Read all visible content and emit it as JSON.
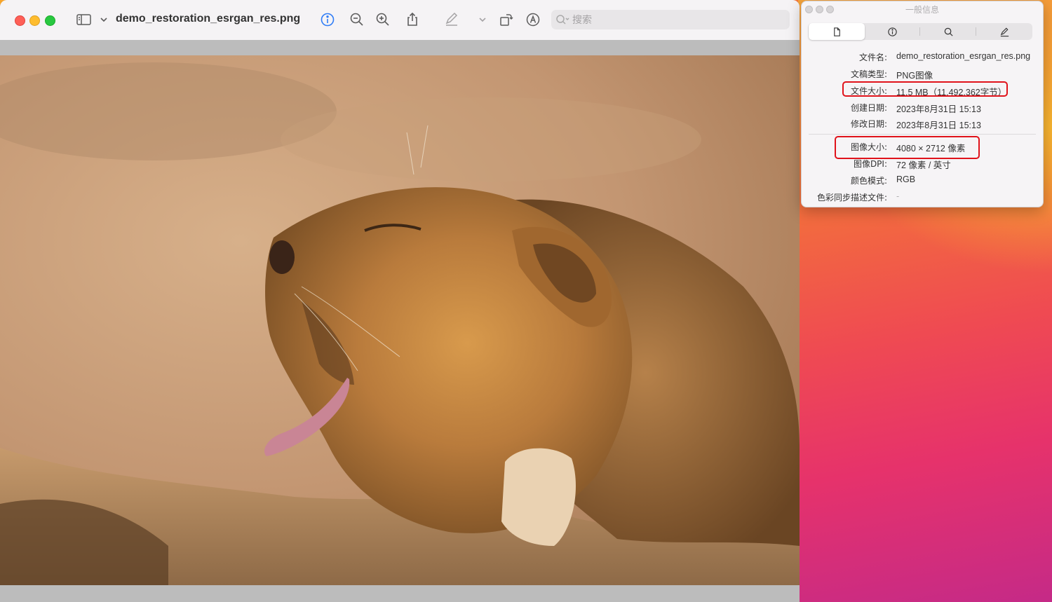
{
  "preview": {
    "title": "demo_restoration_esrgan_res.png",
    "search_placeholder": "搜索",
    "toolbar_icons": [
      "sidebar-icon",
      "chevron-down-icon",
      "info-icon",
      "zoom-out-icon",
      "zoom-in-icon",
      "share-icon",
      "markup-pen-icon",
      "chevron-down-icon",
      "rotate-icon",
      "markup-circle-icon",
      "search-icon"
    ],
    "accent": "#2f7cf6"
  },
  "info": {
    "window_title": "一般信息",
    "tabs": [
      "file-icon",
      "info-icon",
      "search-icon",
      "pen-icon"
    ],
    "file": {
      "name_label": "文件名:",
      "name_value": "demo_restoration_esrgan_res.png",
      "kind_label": "文稿类型:",
      "kind_value": "PNG图像",
      "size_label": "文件大小:",
      "size_value": "11.5 MB（11,492,362字节）",
      "created_label": "创建日期:",
      "created_value": "2023年8月31日 15:13",
      "modified_label": "修改日期:",
      "modified_value": "2023年8月31日 15:13"
    },
    "image": {
      "dim_label": "图像大小:",
      "dim_value": "4080 × 2712 像素",
      "dpi_label": "图像DPI:",
      "dpi_value": "72 像素 / 英寸",
      "color_label": "颜色模式:",
      "color_value": "RGB",
      "profile_label": "色彩同步描述文件:",
      "profile_value": "-"
    },
    "highlight_color": "#e0131b"
  }
}
